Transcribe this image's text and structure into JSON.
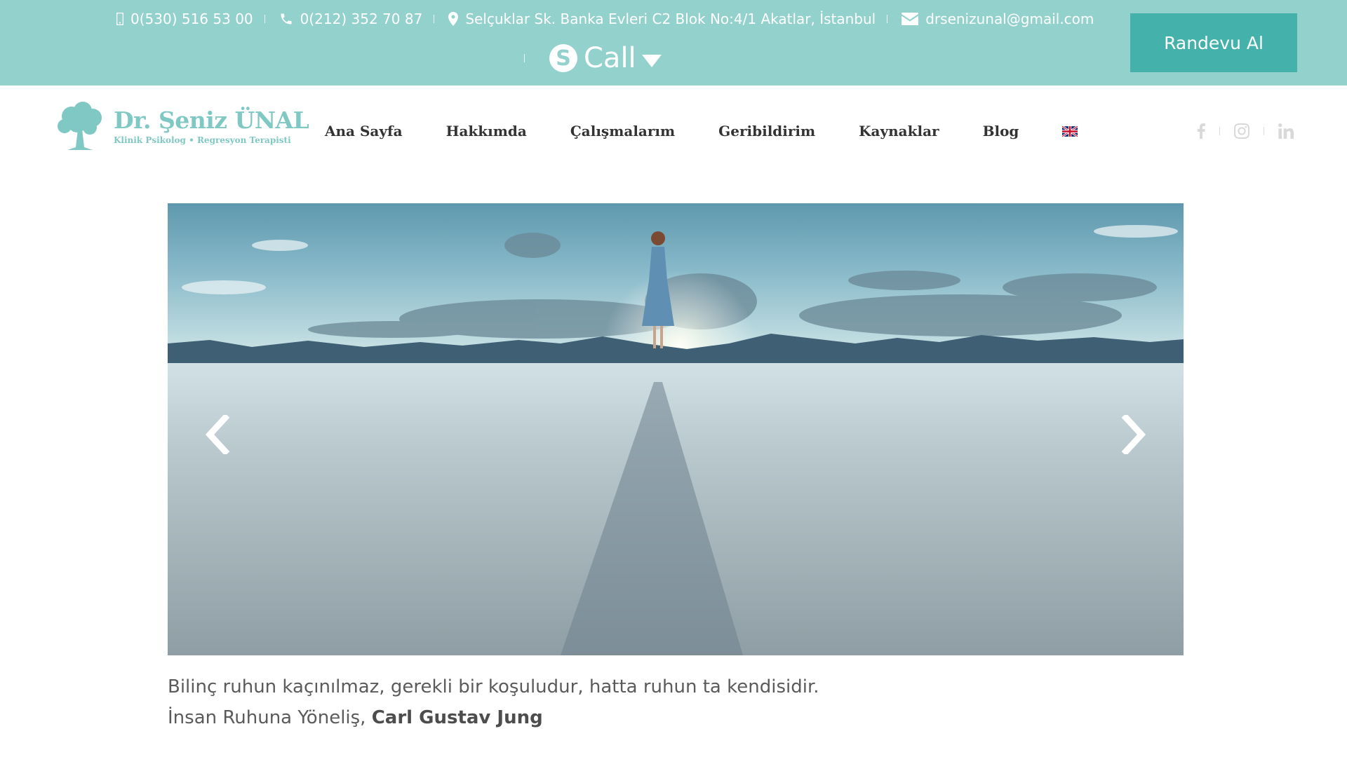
{
  "topbar": {
    "mobile_phone": "0(530) 516 53 00",
    "landline_phone": "0(212) 352 70 87",
    "address": "Selçuklar Sk. Banka Evleri C2 Blok No:4/1 Akatlar, İstanbul",
    "email": "drsenizunal@gmail.com",
    "skype_label": "Call",
    "appointment_button": "Randevu Al",
    "background_color": "#93d1cd",
    "button_color": "#44b1aa"
  },
  "header": {
    "logo_name": "Dr. Şeniz ÜNAL",
    "logo_subtitle": "Klinik Psikolog • Regresyon Terapisti",
    "nav": [
      {
        "label": "Ana Sayfa"
      },
      {
        "label": "Hakkımda"
      },
      {
        "label": "Çalışmalarım"
      },
      {
        "label": "Geribildirim"
      },
      {
        "label": "Kaynaklar"
      },
      {
        "label": "Blog"
      }
    ],
    "language_icon": "uk-flag-icon",
    "social_icons": [
      "facebook-icon",
      "instagram-icon",
      "linkedin-icon"
    ]
  },
  "hero": {
    "image": "woman-walking-on-salt-flat",
    "prev_icon": "chevron-left-icon",
    "next_icon": "chevron-right-icon"
  },
  "quote": {
    "text": "Bilinç ruhun kaçınılmaz, gerekli bir koşuludur, hatta ruhun ta kendisidir.",
    "source_prefix": "İnsan Ruhuna Yöneliş, ",
    "author": "Carl Gustav Jung"
  }
}
